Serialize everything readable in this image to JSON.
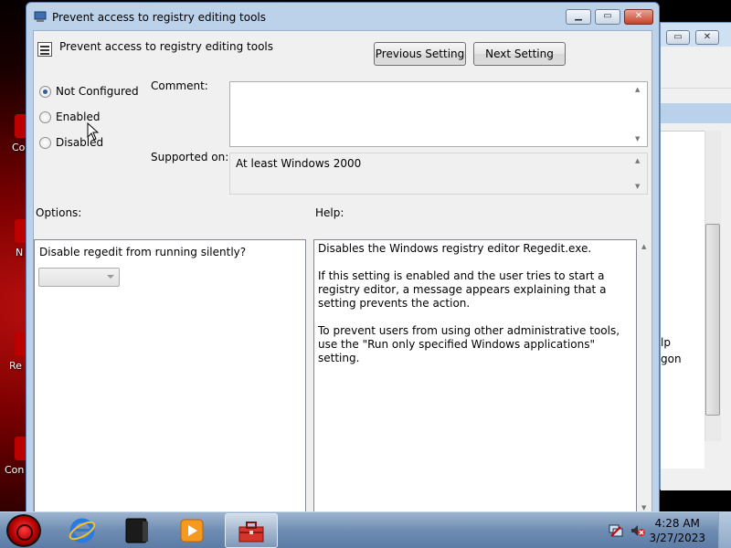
{
  "window": {
    "title": "Prevent access to registry editing tools",
    "minimize_icon": "minimize-icon",
    "maximize_icon": "maximize-icon",
    "close_icon": "close-icon"
  },
  "header": {
    "setting_name": "Prevent access to registry editing tools",
    "previous_label": "Previous Setting",
    "next_label": "Next Setting"
  },
  "state": {
    "options": [
      {
        "label": "Not Configured",
        "selected": true
      },
      {
        "label": "Enabled",
        "selected": false
      },
      {
        "label": "Disabled",
        "selected": false
      }
    ]
  },
  "comment": {
    "label": "Comment:",
    "value": ""
  },
  "supported": {
    "label": "Supported on:",
    "value": "At least Windows 2000"
  },
  "options_panel": {
    "label": "Options:",
    "question": "Disable regedit from running silently?",
    "dropdown_value": ""
  },
  "help_panel": {
    "label": "Help:",
    "text": "Disables the Windows registry editor Regedit.exe.\n\nIf this setting is enabled and the user tries to start a registry editor, a message appears explaining that a setting prevents the action.\n\nTo prevent users from using other administrative tools, use the \"Run only specified Windows applications\" setting."
  },
  "background_window": {
    "text_1": "lp",
    "text_2": "gon"
  },
  "desktop_icons": [
    "Co",
    "N",
    "Re",
    "Con"
  ],
  "taskbar": {
    "icons": [
      "start-orb-icon",
      "internet-explorer-icon",
      "media-center-icon",
      "media-player-icon",
      "toolbox-icon"
    ],
    "time": "4:28 AM",
    "date": "3/27/2023"
  },
  "colors": {
    "title_bar": "#bcd2ea",
    "taskbar": "#6f8db3",
    "close_button": "#c7412a"
  }
}
